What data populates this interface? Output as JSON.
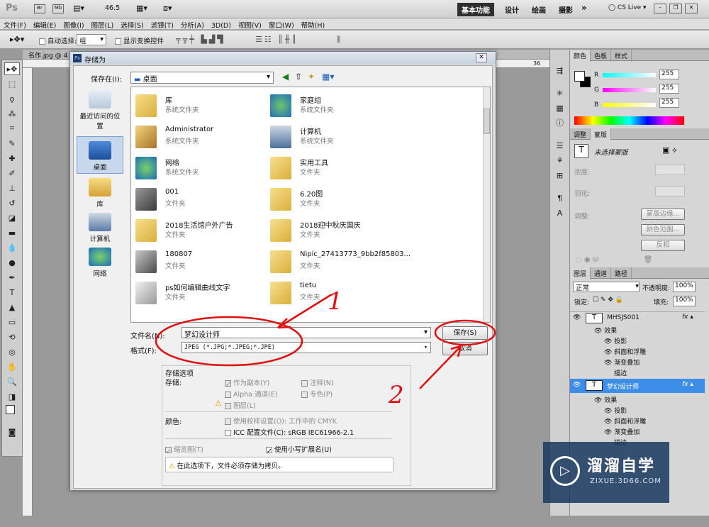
{
  "app": {
    "logo": "Ps",
    "zoom": "46.5",
    "workspace": [
      "基本功能",
      "设计",
      "绘画",
      "摄影"
    ],
    "cs_live": "CS Live"
  },
  "menu": [
    "文件(F)",
    "编辑(E)",
    "图像(I)",
    "图层(L)",
    "选择(S)",
    "滤镜(T)",
    "分析(A)",
    "3D(D)",
    "视图(V)",
    "窗口(W)",
    "帮助(H)"
  ],
  "options": {
    "auto_select_label": "自动选择:",
    "auto_select_value": "组",
    "show_transform": "显示变换控件"
  },
  "doc_tab": "名作.jpg @ 4",
  "dialog": {
    "title": "存储为",
    "save_in_label": "保存在(I):",
    "save_in_value": "桌面",
    "places": [
      {
        "label": "最近访问的位置"
      },
      {
        "label": "桌面"
      },
      {
        "label": "库"
      },
      {
        "label": "计算机"
      },
      {
        "label": "网络"
      }
    ],
    "files": [
      {
        "name": "库",
        "type": "系统文件夹"
      },
      {
        "name": "家庭组",
        "type": "系统文件夹"
      },
      {
        "name": "Administrator",
        "type": "系统文件夹"
      },
      {
        "name": "计算机",
        "type": "系统文件夹"
      },
      {
        "name": "网络",
        "type": "系统文件夹"
      },
      {
        "name": "实用工具",
        "type": "文件夹"
      },
      {
        "name": "001",
        "type": "文件夹"
      },
      {
        "name": "6.20图",
        "type": "文件夹"
      },
      {
        "name": "2018生活馆户外广告",
        "type": "文件夹"
      },
      {
        "name": "2018迎中秋庆国庆",
        "type": "文件夹"
      },
      {
        "name": "180807",
        "type": "文件夹"
      },
      {
        "name": "Nipic_27413773_9bb2f85803...",
        "type": "文件夹"
      },
      {
        "name": "ps如何编辑曲线文字",
        "type": "文件夹"
      },
      {
        "name": "tietu",
        "type": "文件夹"
      }
    ],
    "filename_label": "文件名(N):",
    "filename_value": "梦幻设计师",
    "format_label": "格式(F):",
    "format_value": "JPEG (*.JPG;*.JPEG;*.JPE)",
    "save_button": "保存(S)",
    "cancel_button": "取消",
    "save_options_title": "存储选项",
    "save_label": "存储:",
    "as_copy": "作为副本(Y)",
    "notes": "注释(N)",
    "alpha": "Alpha 通道(E)",
    "spot": "专色(P)",
    "layers": "图层(L)",
    "color_label": "颜色:",
    "use_proof": "使用校样设置(O): 工作中的 CMYK",
    "icc": "ICC 配置文件(C): sRGB IEC61966-2.1",
    "thumbnail": "缩览图(T)",
    "lowercase_ext": "使用小写扩展名(U)",
    "warning": "在此选项下，文件必须存储为拷贝。"
  },
  "annotations": {
    "mark1": "1",
    "mark2": "2"
  },
  "color_panel": {
    "tabs": [
      "颜色",
      "色板",
      "样式"
    ],
    "r_label": "R",
    "g_label": "G",
    "b_label": "B",
    "r": "255",
    "g": "255",
    "b": "255"
  },
  "masks_panel": {
    "tabs": [
      "调整",
      "蒙版"
    ],
    "title": "未选择蒙版",
    "density": "浓度:",
    "feather": "羽化:",
    "refine": "调整:",
    "btn_edge": "蒙版边缘...",
    "btn_range": "颜色范围...",
    "btn_invert": "反相"
  },
  "layers_panel": {
    "tabs": [
      "图层",
      "通道",
      "路径"
    ],
    "blend": "正常",
    "opacity_label": "不透明度:",
    "opacity": "100%",
    "lock_label": "锁定:",
    "fill_label": "填充:",
    "fill": "100%",
    "layers": [
      {
        "name": "MHSJS001",
        "effects_label": "效果",
        "effects": [
          "投影",
          "斜面和浮雕",
          "渐变叠加",
          "描边"
        ]
      },
      {
        "name": "梦幻设计师",
        "effects_label": "效果",
        "effects": [
          "投影",
          "斜面和浮雕",
          "渐变叠加",
          "描边"
        ]
      }
    ]
  },
  "watermark": {
    "title": "溜溜自学",
    "url": "ZIXUE.3D66.COM"
  }
}
